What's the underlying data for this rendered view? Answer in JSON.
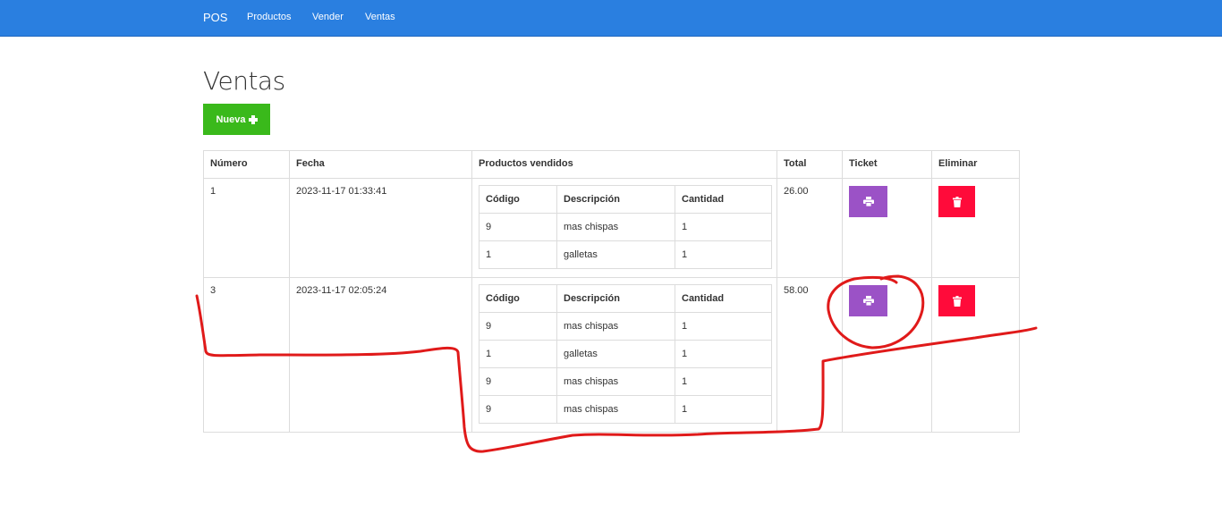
{
  "navbar": {
    "brand": "POS",
    "links": [
      "Productos",
      "Vender",
      "Ventas"
    ]
  },
  "page": {
    "title": "Ventas",
    "new_button_label": "Nueva"
  },
  "table": {
    "headers": [
      "Número",
      "Fecha",
      "Productos vendidos",
      "Total",
      "Ticket",
      "Eliminar"
    ],
    "inner_headers": [
      "Código",
      "Descripción",
      "Cantidad"
    ],
    "rows": [
      {
        "numero": "1",
        "fecha": "2023-11-17 01:33:41",
        "productos": [
          {
            "codigo": "9",
            "descripcion": "mas chispas",
            "cantidad": "1"
          },
          {
            "codigo": "1",
            "descripcion": "galletas",
            "cantidad": "1"
          }
        ],
        "total": "26.00"
      },
      {
        "numero": "3",
        "fecha": "2023-11-17 02:05:24",
        "productos": [
          {
            "codigo": "9",
            "descripcion": "mas chispas",
            "cantidad": "1"
          },
          {
            "codigo": "1",
            "descripcion": "galletas",
            "cantidad": "1"
          },
          {
            "codigo": "9",
            "descripcion": "mas chispas",
            "cantidad": "1"
          },
          {
            "codigo": "9",
            "descripcion": "mas chispas",
            "cantidad": "1"
          }
        ],
        "total": "58.00"
      }
    ]
  },
  "icons": {
    "new": "plus-icon",
    "ticket": "print-icon",
    "delete": "trash-icon"
  },
  "colors": {
    "navbar": "#2a7fe0",
    "new_button": "#3ab91b",
    "print_button": "#9b52c6",
    "delete_button": "#ff0b3a",
    "annotation": "#e01a1a"
  }
}
